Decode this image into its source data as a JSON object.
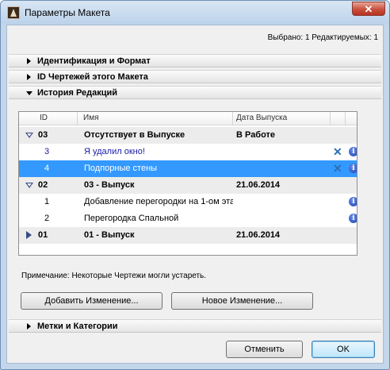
{
  "window": {
    "title": "Параметры Макета",
    "close_label": "✕"
  },
  "selection_info": "Выбрано: 1 Редактируемых: 1",
  "sections": {
    "identification": "Идентификация и Формат",
    "drawing_ids": "ID Чертежей этого Макета",
    "revision_history": "История Редакций",
    "markers": "Метки и Категории"
  },
  "table": {
    "headers": {
      "id": "ID",
      "name": "Имя",
      "date": "Дата Выпуска"
    },
    "rows": [
      {
        "kind": "group",
        "expanded": true,
        "id": "03",
        "name": "Отсутствует в Выпуске",
        "date": "В Работе"
      },
      {
        "kind": "item",
        "id": "3",
        "name": "Я удалил окно!",
        "date": "",
        "icons": [
          "x-icon",
          "info-icon"
        ],
        "text_color": "#1a1aa6"
      },
      {
        "kind": "item",
        "selected": true,
        "id": "4",
        "name": "Подпорные стены",
        "date": "",
        "icons": [
          "x-icon",
          "info-icon"
        ]
      },
      {
        "kind": "group",
        "expanded": true,
        "id": "02",
        "name": "03 - Выпуск",
        "date": "21.06.2014"
      },
      {
        "kind": "item",
        "id": "1",
        "name": "Добавление перегородки на 1-ом эта",
        "date": "",
        "icons": [
          "info-icon"
        ]
      },
      {
        "kind": "item",
        "id": "2",
        "name": "Перегородка Спальной",
        "date": "",
        "icons": [
          "info-icon"
        ]
      },
      {
        "kind": "group",
        "expanded": false,
        "id": "01",
        "name": "01 - Выпуск",
        "date": "21.06.2014"
      }
    ]
  },
  "note": "Примечание: Некоторые Чертежи могли устареть.",
  "buttons": {
    "add_change": "Добавить Изменение...",
    "new_change": "Новое Изменение...",
    "cancel": "Отменить",
    "ok": "OK"
  },
  "colors": {
    "selection": "#3399ff",
    "title_bar": "#c3d6ea",
    "link_text": "#1a1aa6"
  }
}
